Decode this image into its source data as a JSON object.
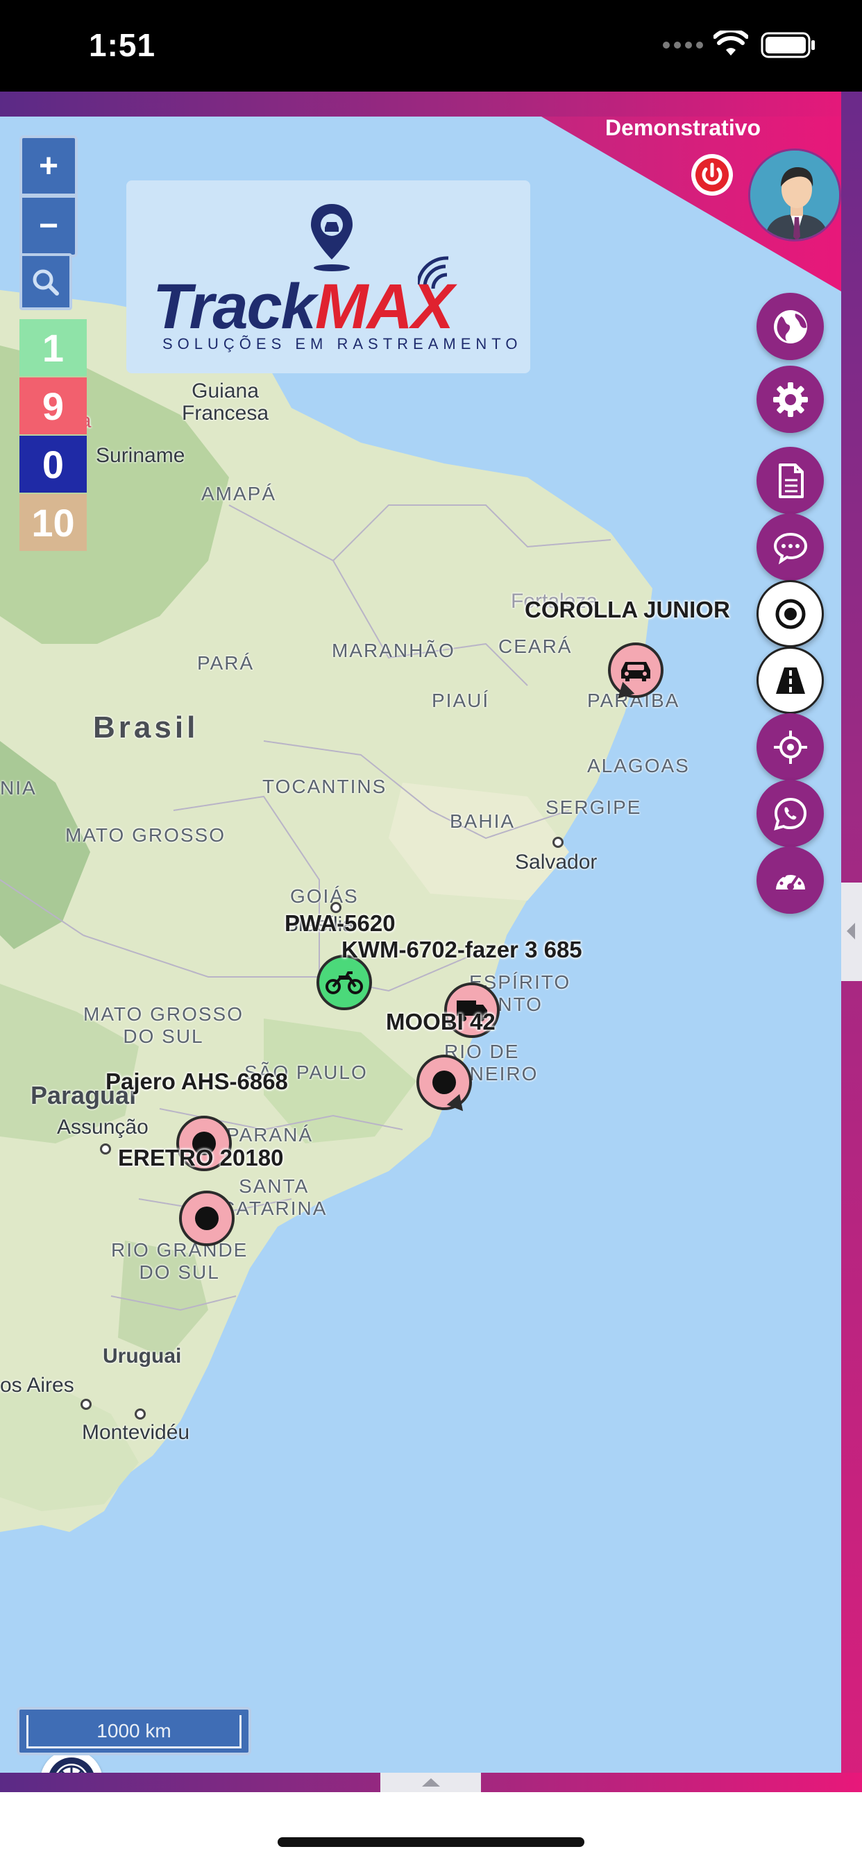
{
  "status_bar": {
    "time": "1:51"
  },
  "header": {
    "user_name": "Demonstrativo"
  },
  "logo": {
    "word_left": "Track",
    "word_right": "MAX",
    "subtitle": "SOLUÇÕES EM RASTREAMENTO"
  },
  "map_controls": {
    "zoom_in": "+",
    "zoom_out": "−",
    "scale_label": "1000 km"
  },
  "status_counts": [
    {
      "value": "1",
      "color": "#8fe3a8"
    },
    {
      "value": "9",
      "color": "#f2606e"
    },
    {
      "value": "0",
      "color": "#1f2aa6"
    },
    {
      "value": "10",
      "color": "#d8b791"
    }
  ],
  "side_buttons": [
    {
      "icon": "globe-icon"
    },
    {
      "icon": "gear-icon"
    },
    {
      "icon": "document-icon"
    },
    {
      "icon": "chat-icon"
    },
    {
      "icon": "target-icon"
    },
    {
      "icon": "road-icon"
    },
    {
      "icon": "crosshair-icon"
    },
    {
      "icon": "whatsapp-icon"
    },
    {
      "icon": "speedometer-icon"
    }
  ],
  "vehicles": [
    {
      "label": "COROLLA JUNIOR",
      "status": "stopped",
      "icon": "car-icon"
    },
    {
      "label": "PWA-5620",
      "status": "moving",
      "icon": "motorcycle-icon"
    },
    {
      "label": "KWM-6702-fazer 3 685",
      "status": "stopped",
      "icon": "truck-icon"
    },
    {
      "label": "MOOBI 42",
      "status": "stopped",
      "icon": "dot-icon"
    },
    {
      "label": "Pajero AHS-6868",
      "status": "stopped",
      "icon": "dot-icon"
    },
    {
      "label": "ERETRO 20180",
      "status": "stopped",
      "icon": "dot-icon"
    }
  ],
  "map_labels": {
    "guiana_francesa": "Guiana\nFrancesa",
    "guiana": "uiana",
    "suriname": "Suriname",
    "amapa": "AMAPÁ",
    "fortaleza": "Fortaleza",
    "ceara": "CEARÁ",
    "para": "PARÁ",
    "maranhao": "MARANHÃO",
    "piaui": "PIAUÍ",
    "paraiba": "PARAÍBA",
    "brasil": "Brasil",
    "alagoas": "ALAGOAS",
    "nia": "NIA",
    "tocantins": "TOCANTINS",
    "sergipe": "SERGIPE",
    "bahia": "BAHIA",
    "mato_grosso": "MATO GROSSO",
    "salvador": "Salvador",
    "goias": "GOIÁS",
    "brasilia": "Brasília",
    "espirito_santo": "ESPÍRITO\nSANTO",
    "mato_grosso_do_sul": "MATO GROSSO\nDO SUL",
    "rio_de_janeiro": "RIO DE\nJANEIRO",
    "sao_paulo": "SÃO PAULO",
    "paraguai": "Paraguai",
    "assuncao": "Assunção",
    "parana": "PARANÁ",
    "santa_catarina": "SANTA\nCATARINA",
    "rio_grande_do_sul": "RIO GRANDE\nDO SUL",
    "uruguai": "Uruguai",
    "buenos_aires": "os Aires",
    "montevideu": "Montevidéu"
  }
}
